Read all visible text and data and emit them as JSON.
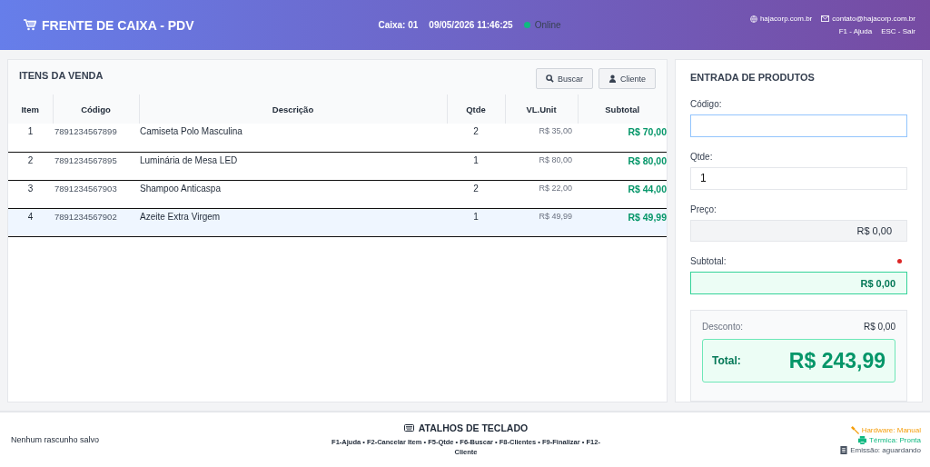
{
  "header": {
    "title": "FRENTE DE CAIXA - PDV",
    "register": "Caixa: 01",
    "datetime": "09/05/2026 11:46:25",
    "status": {
      "label": "Online",
      "online": true
    },
    "website": "hajacorp.com.br",
    "email": "contato@hajacorp.com.br",
    "help": "F1 - Ajuda",
    "exit": "ESC - Sair"
  },
  "items_panel": {
    "title": "ITENS DA VENDA",
    "buttons": [
      {
        "label": "Buscar",
        "kind": "search"
      },
      {
        "label": "Cliente",
        "kind": "user"
      }
    ],
    "columns": [
      "Item",
      "Código",
      "Descrição",
      "Qtde",
      "VL.Unit",
      "Subtotal"
    ],
    "rows": [
      {
        "item": "1",
        "code": "7891234567899",
        "description": "Camiseta Polo Masculina",
        "qty": "2",
        "unit": "R$ 35,00",
        "subtotal": "R$ 70,00",
        "selected": false
      },
      {
        "item": "2",
        "code": "7891234567895",
        "description": "Luminária de Mesa LED",
        "qty": "1",
        "unit": "R$ 80,00",
        "subtotal": "R$ 80,00",
        "selected": false
      },
      {
        "item": "3",
        "code": "7891234567903",
        "description": "Shampoo Anticaspa",
        "qty": "2",
        "unit": "R$ 22,00",
        "subtotal": "R$ 44,00",
        "selected": false
      },
      {
        "item": "4",
        "code": "7891234567902",
        "description": "Azeite Extra Virgem",
        "qty": "1",
        "unit": "R$ 49,99",
        "subtotal": "R$ 49,99",
        "selected": true
      }
    ]
  },
  "entry_panel": {
    "title": "ENTRADA DE PRODUTOS",
    "code": {
      "label": "Código:"
    },
    "qty": {
      "label": "Qtde:",
      "value": "1"
    },
    "price": {
      "label": "Preço:",
      "value": "R$ 0,00"
    },
    "subtotal": {
      "label": "Subtotal:",
      "value": "R$ 0,00"
    },
    "discount": {
      "label": "Desconto:",
      "value": "R$ 0,00"
    },
    "total": {
      "label": "Total:",
      "value": "R$ 243,99"
    }
  },
  "footer": {
    "draft": "Nenhum rascunho salvo",
    "shortcuts_title": "ATALHOS DE TECLADO",
    "shortcuts": "F1-Ajuda • F2-Cancelar Item • F5-Qtde • F6-Buscar • F8-Clientes • F9-Finalizar • F12-Cliente",
    "status": [
      {
        "label": "Hardware: Manual",
        "kind": "wrench",
        "color": "#f59e0b"
      },
      {
        "label": "Térmica: Pronta",
        "kind": "printer",
        "color": "#10b981"
      },
      {
        "label": "Emissão: aguardando",
        "kind": "document",
        "color": "#4b5563"
      }
    ]
  }
}
